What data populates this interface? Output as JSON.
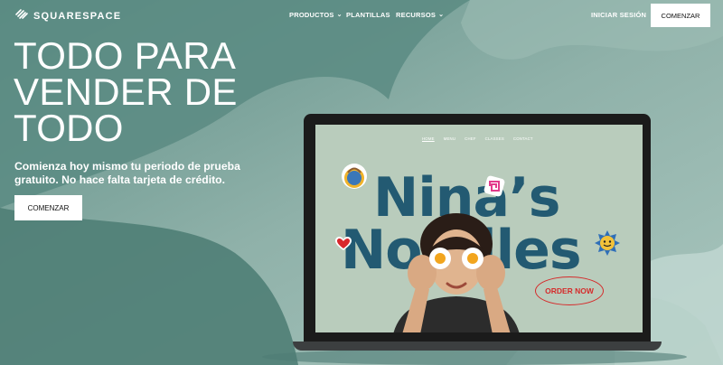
{
  "brand": {
    "name": "SQUARESPACE",
    "logo_icon": "squarespace-logo-icon"
  },
  "nav": {
    "items": [
      {
        "label": "PRODUCTOS",
        "has_dropdown": true
      },
      {
        "label": "PLANTILLAS",
        "has_dropdown": false
      },
      {
        "label": "RECURSOS",
        "has_dropdown": true
      }
    ],
    "login": "INICIAR SESIÓN",
    "cta": "COMENZAR"
  },
  "hero": {
    "title_lines": [
      "TODO PARA",
      "VENDER DE",
      "TODO"
    ],
    "subtitle": "Comienza hoy mismo tu periodo de prueba gratuito. No hace falta tarjeta de crédito.",
    "cta": "COMENZAR"
  },
  "preview_site": {
    "nav": [
      "HOME",
      "MENU",
      "CHEF",
      "CLASSES",
      "CONTACT"
    ],
    "headline_lines": [
      "Nina’s",
      "Noodles"
    ],
    "order_button": "ORDER NOW",
    "stickers": [
      "noodle-bowl-icon",
      "spiral-icon",
      "heart-icon",
      "face-badge-icon"
    ]
  },
  "colors": {
    "background": "#7fa39c",
    "headline_blue": "#235a72",
    "order_red": "#d52b2b",
    "screen_bg": "#b9ccbc"
  }
}
